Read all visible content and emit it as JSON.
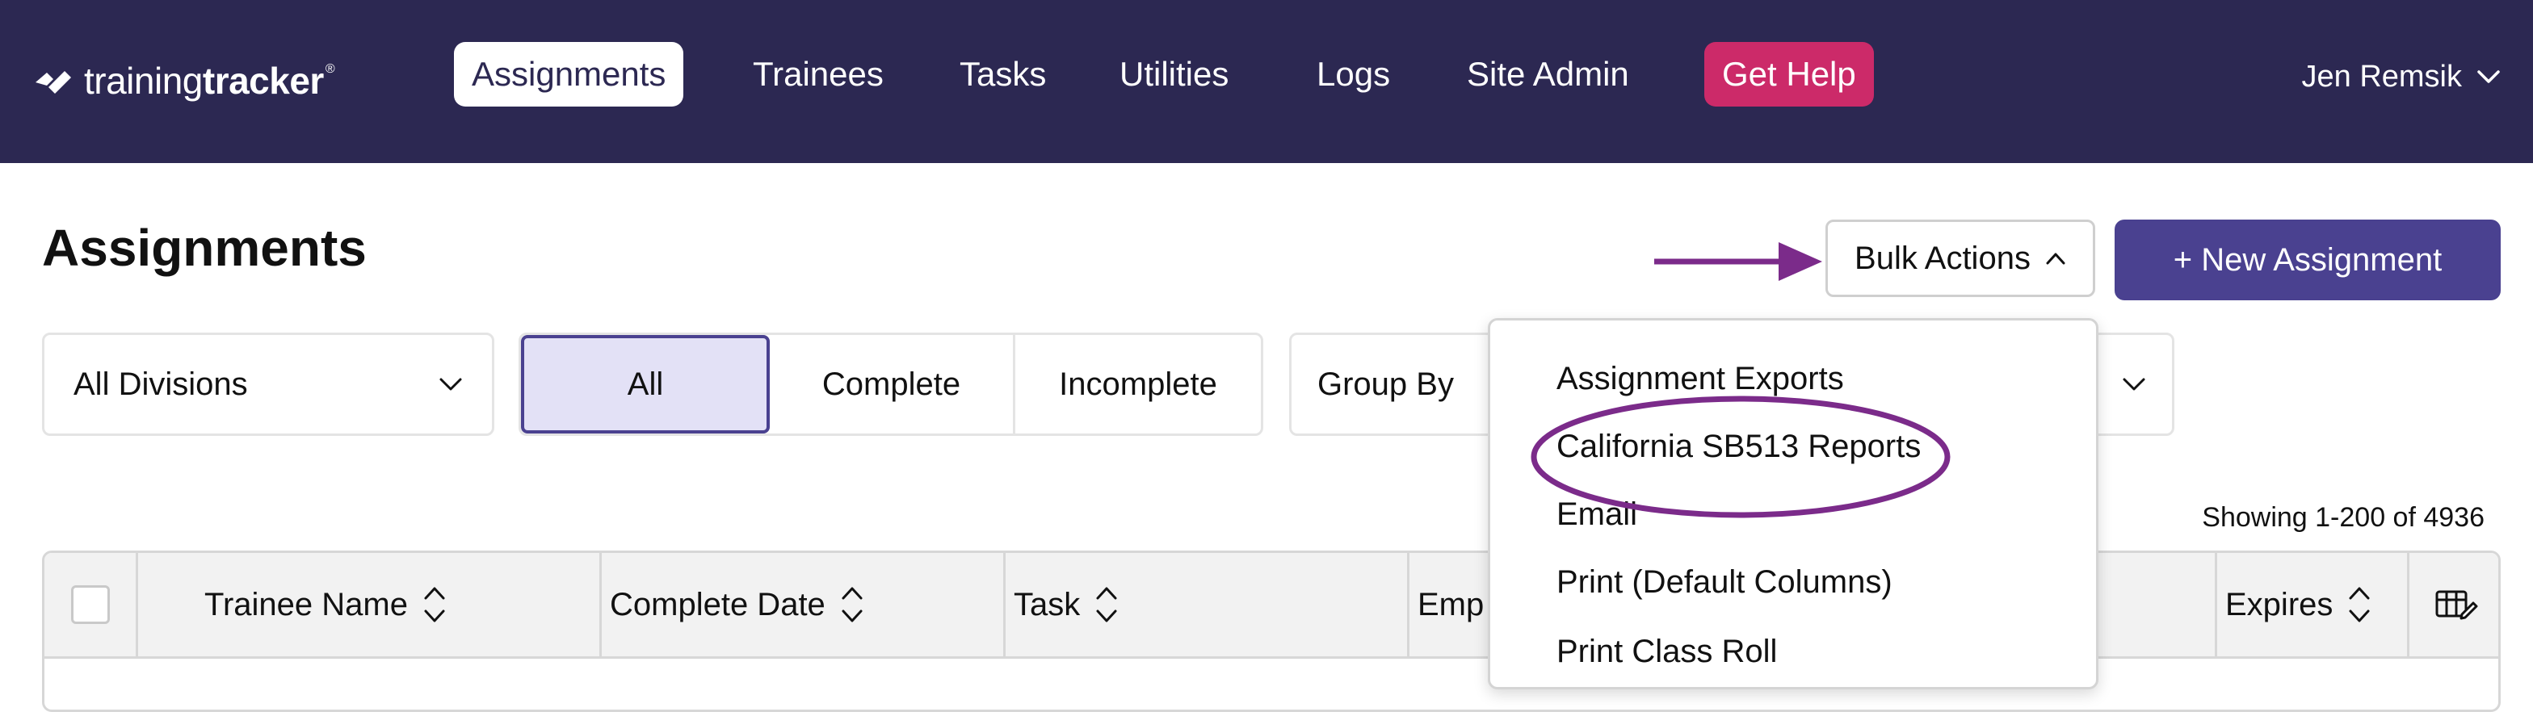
{
  "app": {
    "logo_left": "training",
    "logo_right": "tracker",
    "logo_reg": "®"
  },
  "nav": {
    "items": [
      {
        "label": "Assignments",
        "active": true
      },
      {
        "label": "Trainees"
      },
      {
        "label": "Tasks"
      },
      {
        "label": "Utilities"
      },
      {
        "label": "Logs"
      },
      {
        "label": "Site Admin"
      },
      {
        "label": "Get Help",
        "highlight": true
      }
    ],
    "user": "Jen Remsik"
  },
  "page": {
    "title": "Assignments",
    "bulk_actions_label": "Bulk Actions",
    "new_assignment_label": "+ New Assignment"
  },
  "filters": {
    "division": "All Divisions",
    "status_options": [
      "All",
      "Complete",
      "Incomplete"
    ],
    "status_selected": "All",
    "group_by": "Group By"
  },
  "showing": "Showing 1-200 of 4936",
  "table": {
    "columns": [
      "Trainee Name",
      "Complete Date",
      "Task",
      "Emp",
      "Expires"
    ]
  },
  "bulk_menu": {
    "items": [
      "Assignment Exports",
      "California SB513 Reports",
      "Email",
      "Print (Default Columns)",
      "Print Class Roll"
    ],
    "highlighted_index": 1
  },
  "colors": {
    "nav_bg": "#2c2852",
    "accent": "#4a4190",
    "help": "#cc2a69",
    "annotation": "#7b2b8a"
  }
}
